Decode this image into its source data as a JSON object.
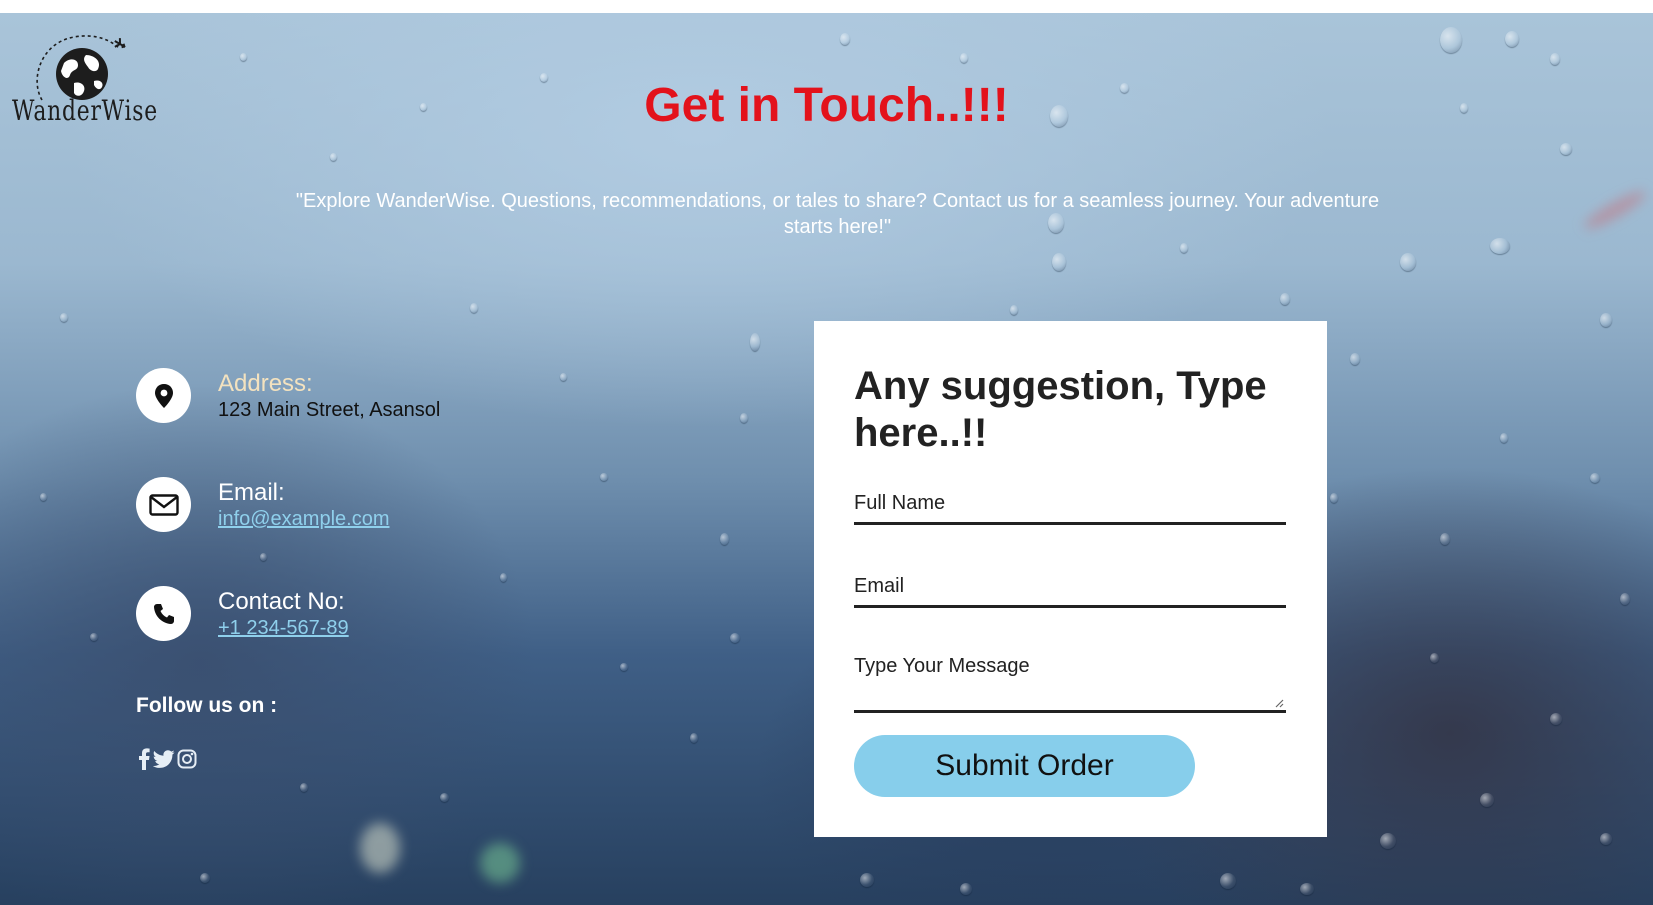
{
  "brand": {
    "name": "WanderWise",
    "logo_icon": "globe-airplane-icon"
  },
  "header": {
    "title": "Get in Touch..!!!",
    "tagline": "\"Explore WanderWise. Questions, recommendations, or tales to share? Contact us for a seamless journey. Your adventure starts here!\""
  },
  "contact": {
    "address": {
      "icon": "map-pin-icon",
      "label": "Address:",
      "value": "123 Main Street, Asansol"
    },
    "email": {
      "icon": "envelope-icon",
      "label": "Email:",
      "value": "info@example.com"
    },
    "phone": {
      "icon": "phone-icon",
      "label": "Contact No:",
      "value": "+1 234-567-89"
    }
  },
  "social": {
    "heading": "Follow us on :",
    "icons": [
      "facebook-icon",
      "twitter-icon",
      "instagram-icon"
    ]
  },
  "form": {
    "heading": "Any suggestion, Type here..!!",
    "name_placeholder": "Full Name",
    "email_placeholder": "Email",
    "message_placeholder": "Type Your Message",
    "submit_label": "Submit Order"
  },
  "colors": {
    "title": "#e3121b",
    "address_label": "#f3e2bf",
    "info_label": "#ffffff",
    "link": "#8fd0ec",
    "submit_button": "#87ceeb"
  }
}
